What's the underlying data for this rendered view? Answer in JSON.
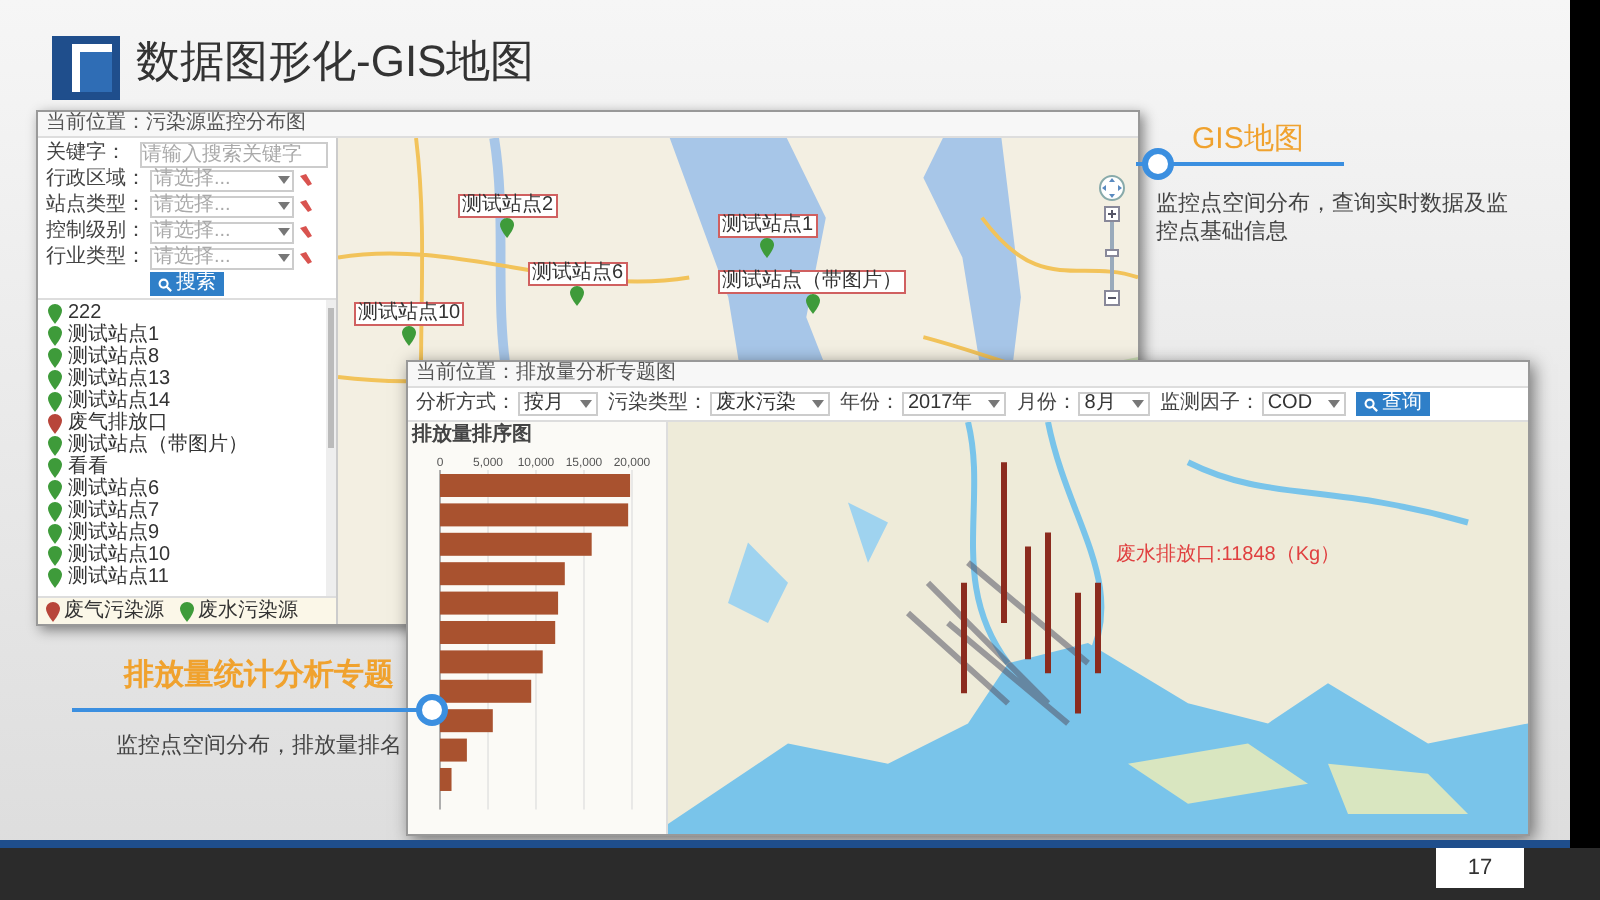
{
  "slide": {
    "title": "数据图形化-GIS地图",
    "page_number": "17"
  },
  "callouts": [
    {
      "title": "GIS地图",
      "description": "监控点空间分布，查询实时数据及监控点基础信息"
    },
    {
      "title": "排放量统计分析专题",
      "description": "监控点空间分布，排放量排名"
    }
  ],
  "gis_window": {
    "breadcrumb": "当前位置：污染源监控分布图",
    "filters": [
      {
        "label": "关键字：",
        "kind": "text",
        "placeholder": "请输入搜索关键字"
      },
      {
        "label": "行政区域：",
        "kind": "select",
        "placeholder": "请选择..."
      },
      {
        "label": "站点类型：",
        "kind": "select",
        "placeholder": "请选择..."
      },
      {
        "label": "控制级别：",
        "kind": "select",
        "placeholder": "请选择..."
      },
      {
        "label": "行业类型：",
        "kind": "select",
        "placeholder": "请选择..."
      }
    ],
    "search_button": "搜索",
    "stations": [
      {
        "name": "222",
        "color": "#3e9b3a"
      },
      {
        "name": "测试站点1",
        "color": "#3e9b3a"
      },
      {
        "name": "测试站点8",
        "color": "#3e9b3a"
      },
      {
        "name": "测试站点13",
        "color": "#3e9b3a"
      },
      {
        "name": "测试站点14",
        "color": "#3e9b3a"
      },
      {
        "name": "废气排放口",
        "color": "#b8453a"
      },
      {
        "name": "测试站点（带图片）",
        "color": "#3e9b3a"
      },
      {
        "name": "看看",
        "color": "#3e9b3a"
      },
      {
        "name": "测试站点6",
        "color": "#3e9b3a"
      },
      {
        "name": "测试站点7",
        "color": "#3e9b3a"
      },
      {
        "name": "测试站点9",
        "color": "#3e9b3a"
      },
      {
        "name": "测试站点10",
        "color": "#3e9b3a"
      },
      {
        "name": "测试站点11",
        "color": "#3e9b3a"
      }
    ],
    "legend": [
      {
        "label": "废气污染源",
        "color": "#b8453a"
      },
      {
        "label": "废水污染源",
        "color": "#3e9b3a"
      }
    ],
    "map_markers": [
      {
        "label": "测试站点2"
      },
      {
        "label": "测试站点1"
      },
      {
        "label": "测试站点6"
      },
      {
        "label": "测试站点（带图片）"
      },
      {
        "label": "测试站点10"
      }
    ]
  },
  "analysis_window": {
    "breadcrumb": "当前位置：排放量分析专题图",
    "toolbar": [
      {
        "label": "分析方式：",
        "value": "按月"
      },
      {
        "label": "污染类型：",
        "value": "废水污染"
      },
      {
        "label": "年份：",
        "value": "2017年"
      },
      {
        "label": "月份：",
        "value": "8月"
      },
      {
        "label": "监测因子：",
        "value": "COD"
      }
    ],
    "query_button": "查询",
    "chart": {
      "title": "排放量排序图",
      "chart_data": {
        "type": "bar",
        "orientation": "horizontal",
        "values": [
          19800,
          19600,
          15800,
          13000,
          12300,
          12000,
          10700,
          9500,
          5500,
          2800,
          1200
        ],
        "xlim": [
          0,
          20000
        ],
        "grid": true,
        "xticks": [
          {
            "value": 0,
            "label": "0"
          },
          {
            "value": 5000,
            "label": "5,000"
          },
          {
            "value": 10000,
            "label": "10,000"
          },
          {
            "value": 15000,
            "label": "15,000"
          },
          {
            "value": 20000,
            "label": "20,000"
          }
        ]
      }
    },
    "map_annotation": "废水排放口:11848（Kg）"
  }
}
